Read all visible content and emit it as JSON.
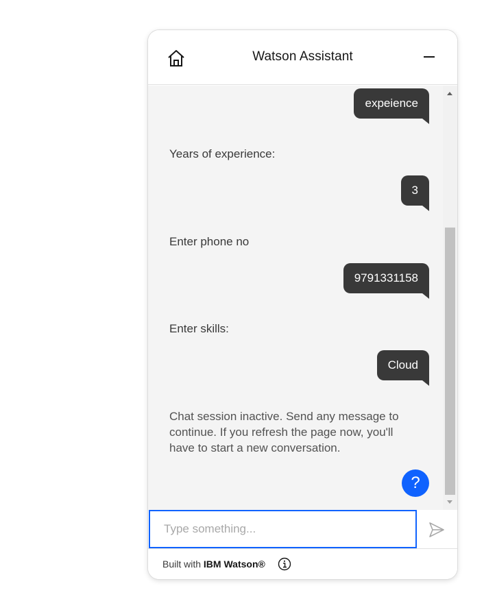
{
  "header": {
    "title": "Watson Assistant",
    "home_icon": "home-icon",
    "minimize_icon": "minimize-icon"
  },
  "messages": [
    {
      "from": "user",
      "text": "expeience"
    },
    {
      "from": "bot",
      "text": "Years of experience:"
    },
    {
      "from": "user",
      "text": "3"
    },
    {
      "from": "bot",
      "text": "Enter phone no"
    },
    {
      "from": "user",
      "text": "9791331158"
    },
    {
      "from": "bot",
      "text": "Enter skills:"
    },
    {
      "from": "user",
      "text": "Cloud"
    }
  ],
  "session_notice": "Chat session inactive. Send any message to continue. If you refresh the page now, you'll have to start a new conversation.",
  "help_button": {
    "label": "?"
  },
  "input": {
    "placeholder": "Type something...",
    "value": ""
  },
  "footer": {
    "prefix": "Built with",
    "brand": "IBM Watson®",
    "info_icon": "info-icon"
  },
  "colors": {
    "accent": "#0f62fe",
    "user_bubble": "#393939",
    "chat_bg": "#f4f4f4"
  }
}
